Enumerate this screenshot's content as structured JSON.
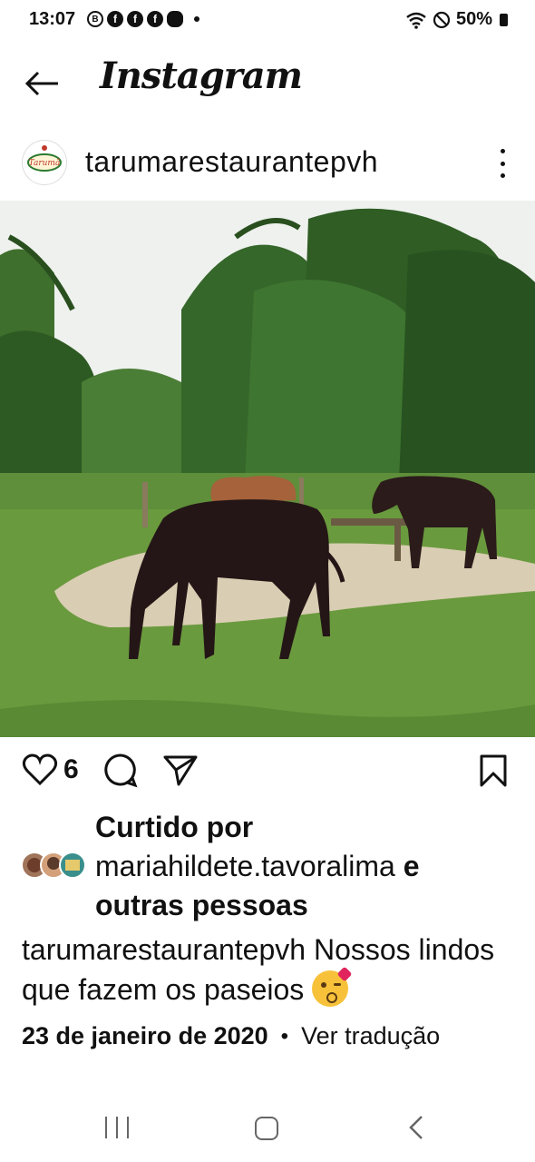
{
  "status_bar": {
    "time": "13:07",
    "battery": "50%",
    "notification_icons": [
      "B",
      "f",
      "f",
      "f"
    ]
  },
  "header": {
    "brand": "Instagram"
  },
  "post": {
    "username": "tarumarestaurantepvh",
    "avatar_text": "Tarumã",
    "likes_count": "6",
    "liked_by": {
      "prefix": "Curtido por",
      "user": "mariahildete.tavoralima",
      "conjunction": "e",
      "suffix": "outras pessoas"
    },
    "caption": {
      "username": "tarumarestaurantepvh",
      "text": "Nossos lindos que fazem os paseios"
    },
    "date": "23 de janeiro de 2020",
    "separator": "•",
    "translate": "Ver tradução"
  },
  "colors": {
    "sky": "#eef1ee",
    "grass": "#5f8f3a",
    "tree_dark": "#2d5a22",
    "horse_dark": "#2b1b1a",
    "horse_chestnut": "#a5623b",
    "dirt": "#d9cdb3"
  }
}
